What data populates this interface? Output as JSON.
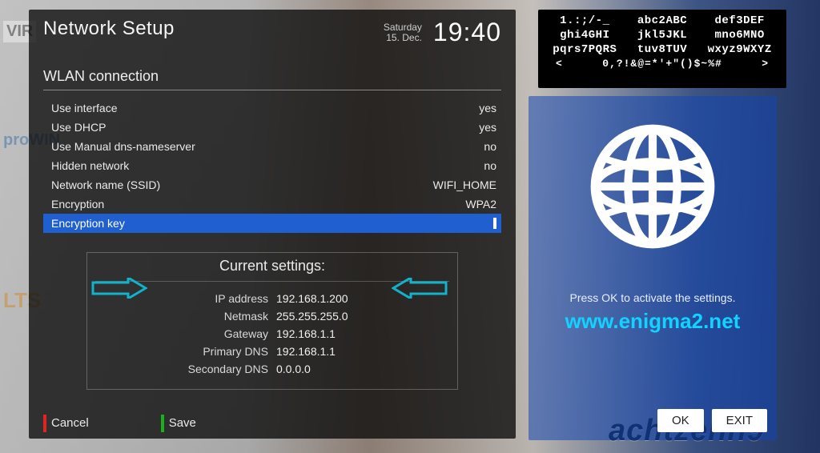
{
  "header": {
    "title": "Network Setup",
    "day": "Saturday",
    "date": "15. Dec.",
    "time": "19:40"
  },
  "wlan": {
    "subhead": "WLAN connection",
    "rows": [
      {
        "label": "Use interface",
        "value": "yes"
      },
      {
        "label": "Use DHCP",
        "value": "yes"
      },
      {
        "label": "Use Manual dns-nameserver",
        "value": "no"
      },
      {
        "label": "Hidden network",
        "value": "no"
      },
      {
        "label": "Network name (SSID)",
        "value": "WIFI_HOME"
      },
      {
        "label": "Encryption",
        "value": "WPA2"
      },
      {
        "label": "Encryption key",
        "value": "",
        "selected": true
      }
    ]
  },
  "current": {
    "title": "Current settings:",
    "rows": [
      {
        "label": "IP address",
        "value": "192.168.1.200",
        "highlight": true
      },
      {
        "label": "Netmask",
        "value": "255.255.255.0"
      },
      {
        "label": "Gateway",
        "value": "192.168.1.1"
      },
      {
        "label": "Primary DNS",
        "value": "192.168.1.1"
      },
      {
        "label": "Secondary DNS",
        "value": "0.0.0.0"
      }
    ]
  },
  "actions": {
    "cancel": "Cancel",
    "save": "Save"
  },
  "osk": {
    "rows": [
      [
        "1.:;/-_",
        "abc2ABC",
        "def3DEF"
      ],
      [
        "ghi4GHI",
        "jkl5JKL",
        "mno6MNO"
      ],
      [
        "pqrs7PQRS",
        "tuv8TUV",
        "wxyz9WXYZ"
      ]
    ],
    "bottom_left": "<",
    "bottom_mid": "0,?!&@=*'+\"()$~%#",
    "bottom_right": ">"
  },
  "right": {
    "hint": "Press OK to activate the settings.",
    "url": "www.enigma2.net",
    "ok": "OK",
    "exit": "EXIT"
  },
  "decor": {
    "bottom_word": "achtzehn9",
    "brand_prowin": "proWIN",
    "brand_lts": "LTS",
    "brand_vir": "VIR"
  },
  "colors": {
    "accent": "#1f5fd0",
    "arrow": "#11b3cc",
    "url": "#11d3ff"
  }
}
